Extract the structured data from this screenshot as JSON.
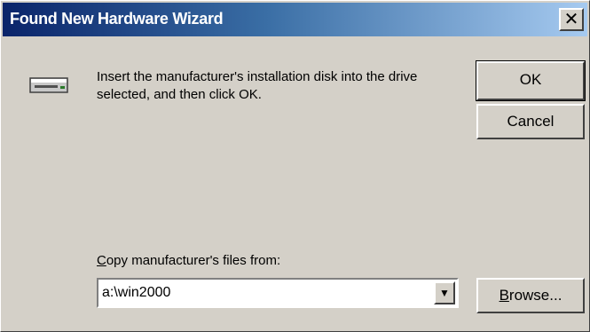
{
  "window": {
    "title": "Found New Hardware Wizard",
    "close_glyph": "✕"
  },
  "message": "Insert the manufacturer's installation disk into the drive\nselected, and then click OK.",
  "buttons": {
    "ok": "OK",
    "cancel": "Cancel",
    "browse_mnemonic": "B",
    "browse_rest": "rowse..."
  },
  "copy_from": {
    "label_mnemonic": "C",
    "label_rest": "opy manufacturer's files from:",
    "value": "a:\\win2000",
    "dropdown_glyph": "▼"
  },
  "icons": {
    "drive": "floppy-drive-icon"
  },
  "colors": {
    "face": "#d4d0c8",
    "title_start": "#0a246a",
    "title_end": "#a6caf0"
  }
}
